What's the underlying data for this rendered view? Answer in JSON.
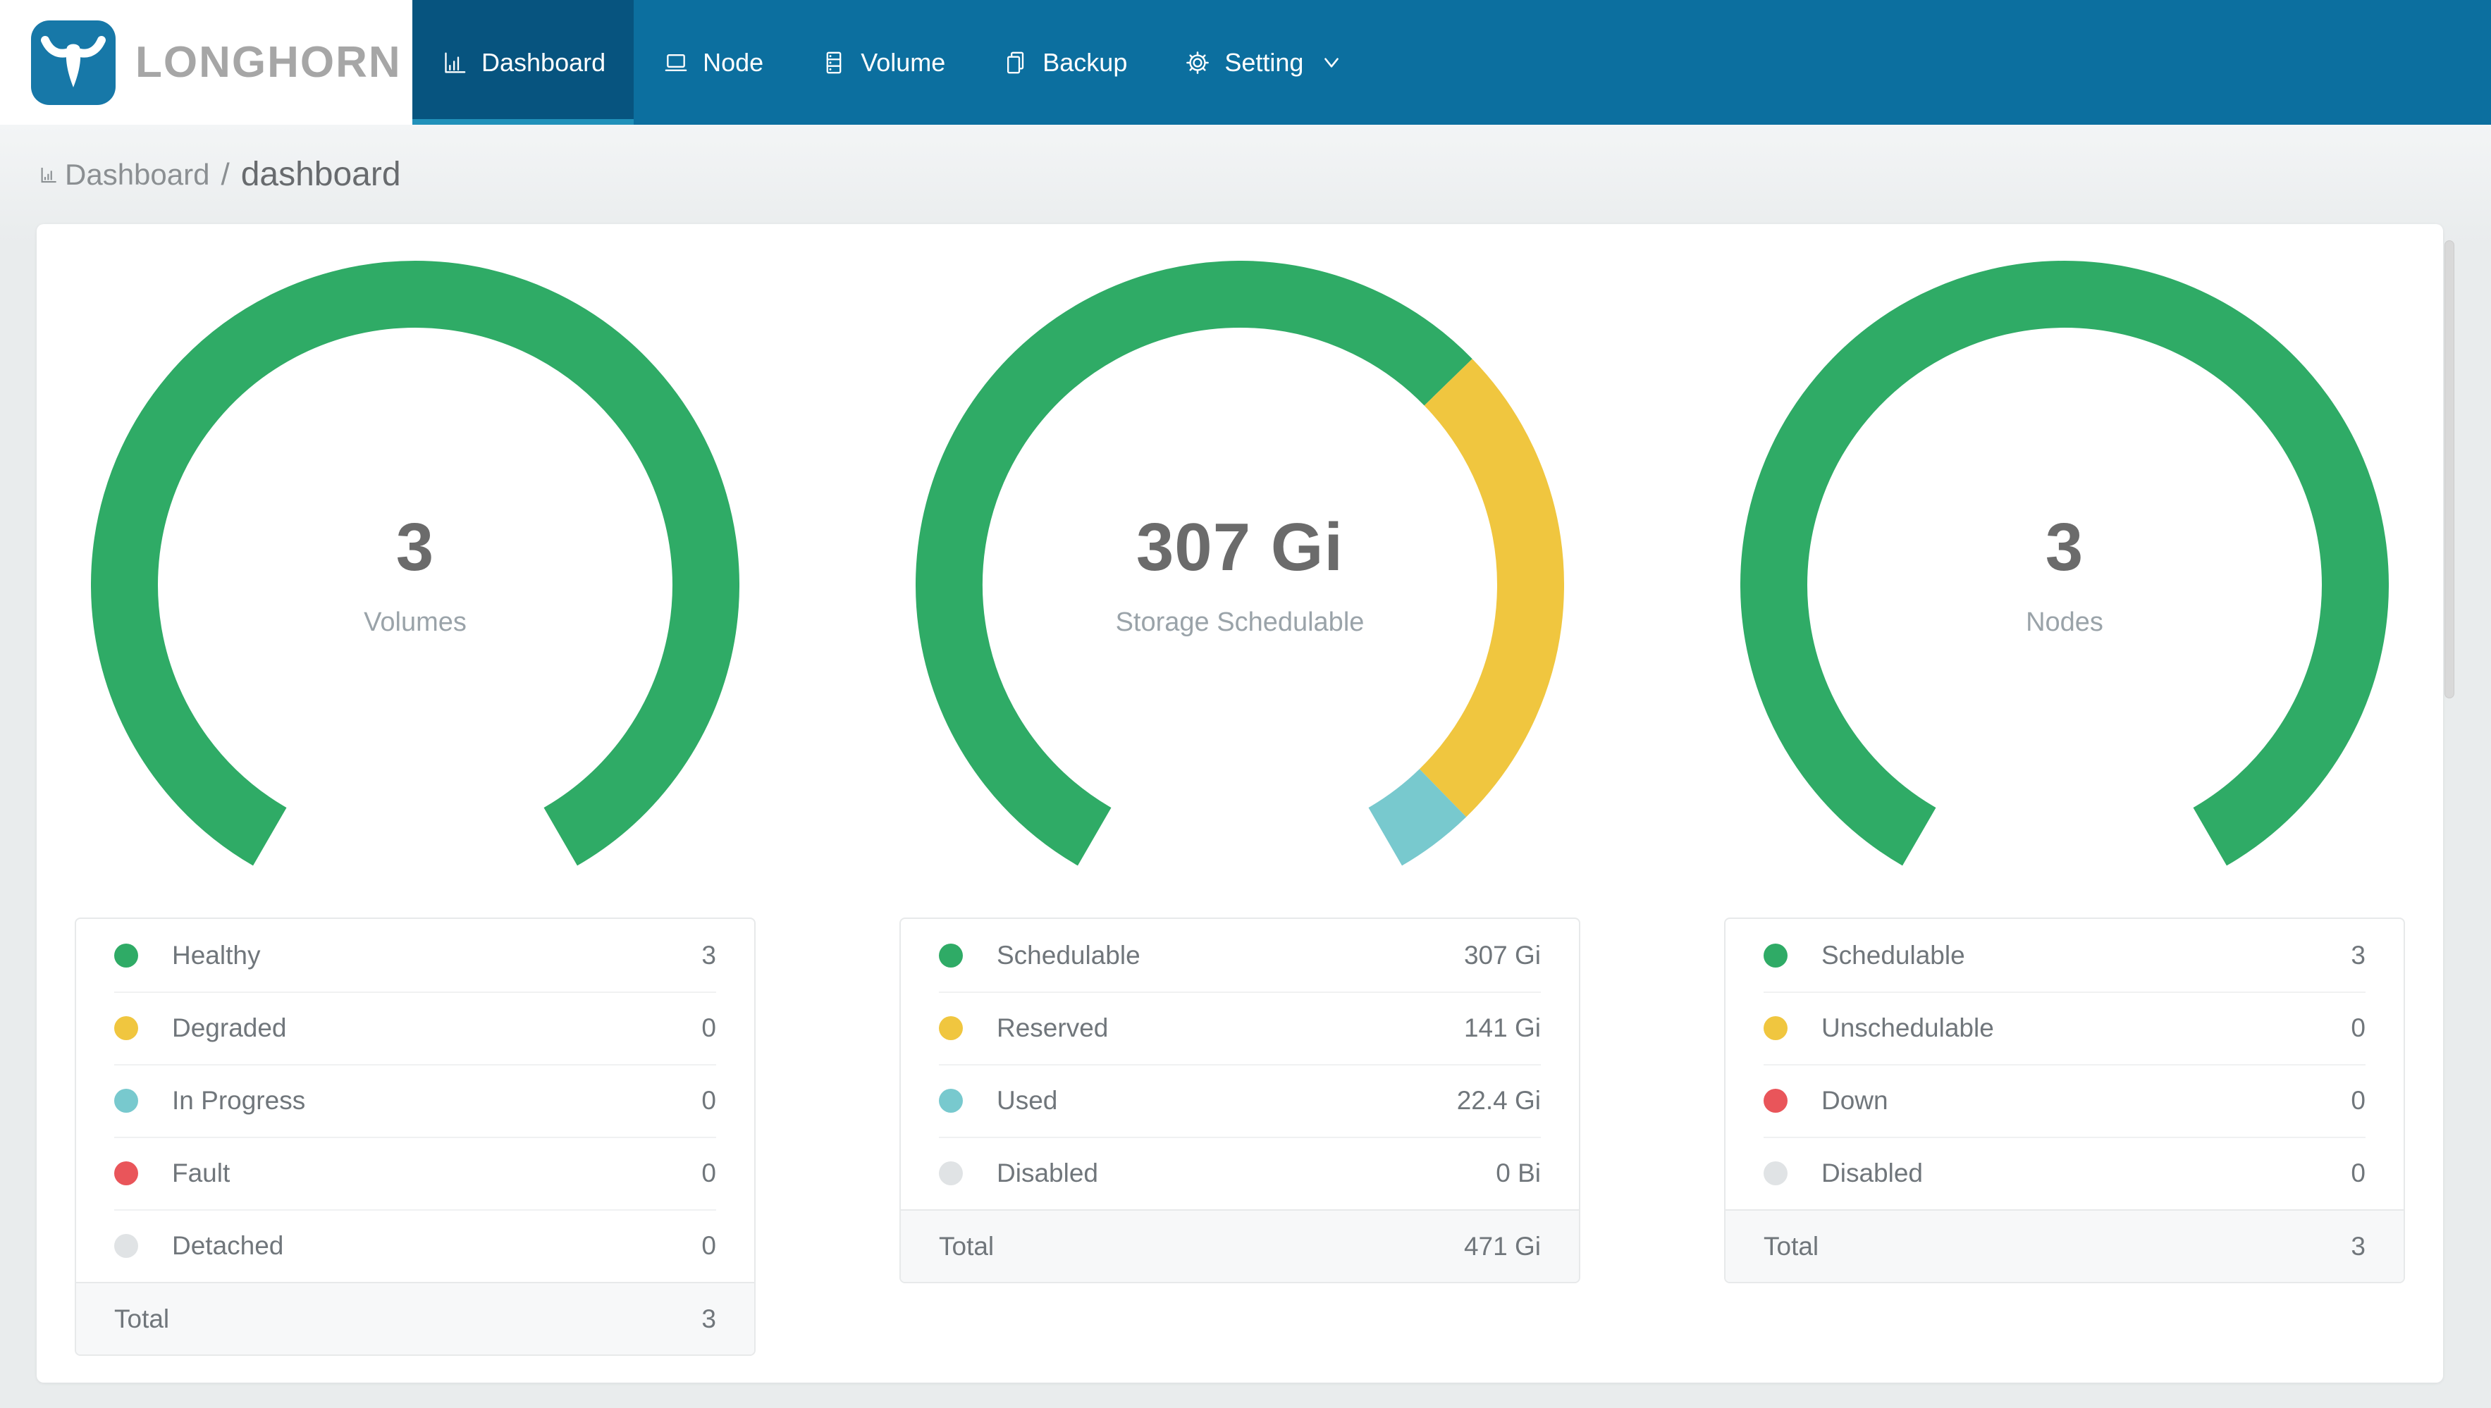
{
  "brand": {
    "name": "LONGHORN",
    "logo_color": "#1778a8"
  },
  "nav": {
    "items": [
      {
        "label": "Dashboard",
        "icon": "bar-chart-icon",
        "active": true
      },
      {
        "label": "Node",
        "icon": "laptop-icon",
        "active": false
      },
      {
        "label": "Volume",
        "icon": "database-icon",
        "active": false
      },
      {
        "label": "Backup",
        "icon": "copy-icon",
        "active": false
      },
      {
        "label": "Setting",
        "icon": "gear-icon",
        "active": false,
        "has_dropdown": true
      }
    ]
  },
  "breadcrumb": {
    "icon": "bar-chart-icon",
    "section": "Dashboard",
    "separator": "/",
    "page": "dashboard"
  },
  "colors": {
    "navbar": "#0c6f9f",
    "navbar_active": "#07547f",
    "navbar_active_underline": "#2191ba",
    "page_background": "#e9eced",
    "healthy_green": "#2fab66",
    "warning_yellow": "#f0c63f",
    "progress_teal": "#78c9ce",
    "fault_red": "#e9555a",
    "disabled_gray": "#e0e3e5"
  },
  "chart_data": [
    {
      "type": "gauge",
      "title": "Volumes",
      "center_value": "3",
      "center_label": "Volumes",
      "start_angle": 210,
      "span_angle": 300,
      "segments": [
        {
          "label": "Healthy",
          "value": 3,
          "display": "3",
          "color": "#2fab66"
        },
        {
          "label": "Degraded",
          "value": 0,
          "display": "0",
          "color": "#f0c63f"
        },
        {
          "label": "In Progress",
          "value": 0,
          "display": "0",
          "color": "#78c9ce"
        },
        {
          "label": "Fault",
          "value": 0,
          "display": "0",
          "color": "#e9555a"
        },
        {
          "label": "Detached",
          "value": 0,
          "display": "0",
          "color": "#e0e3e5"
        }
      ],
      "total": {
        "label": "Total",
        "value": 3,
        "display": "3"
      }
    },
    {
      "type": "gauge",
      "title": "Storage Schedulable",
      "center_value": "307 Gi",
      "center_label": "Storage Schedulable",
      "start_angle": 210,
      "span_angle": 300,
      "segments": [
        {
          "label": "Schedulable",
          "value": 307,
          "display": "307 Gi",
          "color": "#2fab66"
        },
        {
          "label": "Reserved",
          "value": 141,
          "display": "141 Gi",
          "color": "#f0c63f"
        },
        {
          "label": "Used",
          "value": 22.4,
          "display": "22.4 Gi",
          "color": "#78c9ce"
        },
        {
          "label": "Disabled",
          "value": 0,
          "display": "0 Bi",
          "color": "#e0e3e5"
        }
      ],
      "total": {
        "label": "Total",
        "value": 471,
        "display": "471 Gi"
      }
    },
    {
      "type": "gauge",
      "title": "Nodes",
      "center_value": "3",
      "center_label": "Nodes",
      "start_angle": 210,
      "span_angle": 300,
      "segments": [
        {
          "label": "Schedulable",
          "value": 3,
          "display": "3",
          "color": "#2fab66"
        },
        {
          "label": "Unschedulable",
          "value": 0,
          "display": "0",
          "color": "#f0c63f"
        },
        {
          "label": "Down",
          "value": 0,
          "display": "0",
          "color": "#e9555a"
        },
        {
          "label": "Disabled",
          "value": 0,
          "display": "0",
          "color": "#e0e3e5"
        }
      ],
      "total": {
        "label": "Total",
        "value": 3,
        "display": "3"
      }
    }
  ]
}
